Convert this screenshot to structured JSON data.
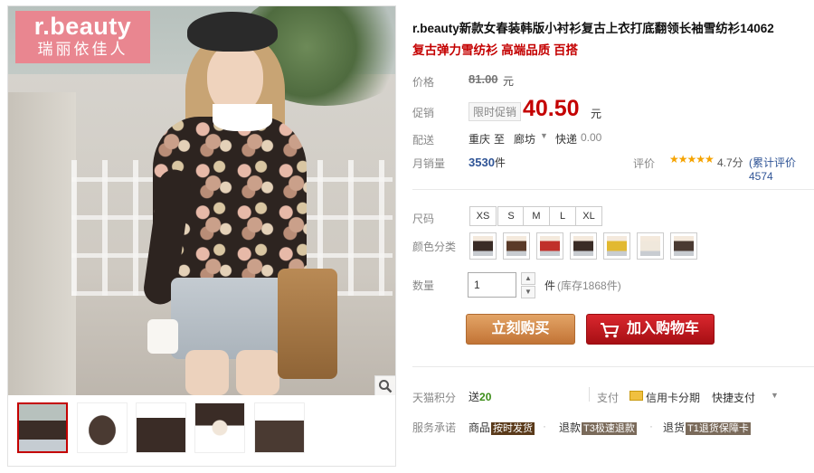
{
  "brand": {
    "name": "r.beauty",
    "sub": "瑞丽依佳人"
  },
  "product": {
    "title": "r.beauty新款女春装韩版小衬衫复古上衣打底翻领长袖雪纺衫14062",
    "subtitle": "复古弹力雪纺衫 高端品质 百搭"
  },
  "price": {
    "label": "价格",
    "original": "81.00",
    "unit": "元"
  },
  "promo": {
    "label": "促销",
    "tag": "限时促销",
    "price": "40.50",
    "unit": "元"
  },
  "shipping": {
    "label": "配送",
    "from": "重庆",
    "to": "至",
    "dest": "廊坊",
    "method": "快递",
    "cost": "0.00"
  },
  "sales": {
    "label": "月销量",
    "count": "3530",
    "unit": "件"
  },
  "rating": {
    "label": "评价",
    "stars": "★★★★★",
    "score": "4.7分",
    "count": "(累计评价4574"
  },
  "size": {
    "label": "尺码",
    "options": [
      "XS",
      "S",
      "M",
      "L",
      "XL"
    ]
  },
  "color": {
    "label": "颜色分类",
    "swatch_colors": [
      "#3a2c26",
      "#5a3a28",
      "#c0302a",
      "#3a2c26",
      "#e2b930",
      "#f0e8dc",
      "#4a3a32"
    ]
  },
  "quantity": {
    "label": "数量",
    "value": "1",
    "unit": "件",
    "stock": "(库存1868件)"
  },
  "buttons": {
    "buy": "立刻购买",
    "cart": "加入购物车"
  },
  "points": {
    "label": "天猫积分",
    "text": "送",
    "value": "20"
  },
  "payment": {
    "label": "支付",
    "credit": "信用卡分期",
    "quick": "快捷支付"
  },
  "service": {
    "label": "服务承诺",
    "items": [
      {
        "prefix": "商品",
        "tag": "按时发货"
      },
      {
        "prefix": "退款",
        "tag": "T3极速退款"
      },
      {
        "prefix": "退货",
        "tag": "T1退货保障卡"
      }
    ]
  },
  "colors": {
    "accent": "#c40000",
    "link": "#2f5496",
    "buy_btn": "#d08040",
    "cart_btn": "#c0141a",
    "brand_pink": "#e98690"
  }
}
